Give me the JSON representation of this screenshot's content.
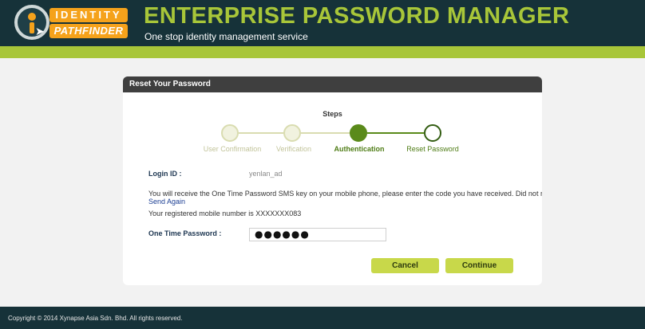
{
  "header": {
    "logo_top": "IDENTITY",
    "logo_bottom": "PATHFINDER",
    "title": "ENTERPRISE PASSWORD MANAGER",
    "subtitle": "One stop identity management service"
  },
  "card": {
    "title": "Reset Your Password",
    "steps_heading": "Steps",
    "steps": [
      {
        "label": "User Confirmation",
        "state": "done"
      },
      {
        "label": "Verification",
        "state": "done"
      },
      {
        "label": "Authentication",
        "state": "active"
      },
      {
        "label": "Reset Password",
        "state": "todo"
      }
    ],
    "login_id_label": "Login ID :",
    "login_id_value": "yenlan_ad",
    "message": "You will receive the One Time Password SMS key on your mobile phone, please enter the code you have received. Did not receive?",
    "send_again": "Send Again",
    "registered_mobile": "Your registered mobile number is XXXXXXX083",
    "otp_label": "One Time Password :",
    "otp_value": "●●●●●●",
    "cancel_label": "Cancel",
    "continue_label": "Continue"
  },
  "footer": {
    "copyright": "Copyright © 2014 Xynapse Asia Sdn. Bhd. All rights reserved."
  },
  "colors": {
    "header_bg": "#163239",
    "accent": "#a8c639",
    "step_active": "#5a8a1a",
    "button": "#c8d84a"
  }
}
